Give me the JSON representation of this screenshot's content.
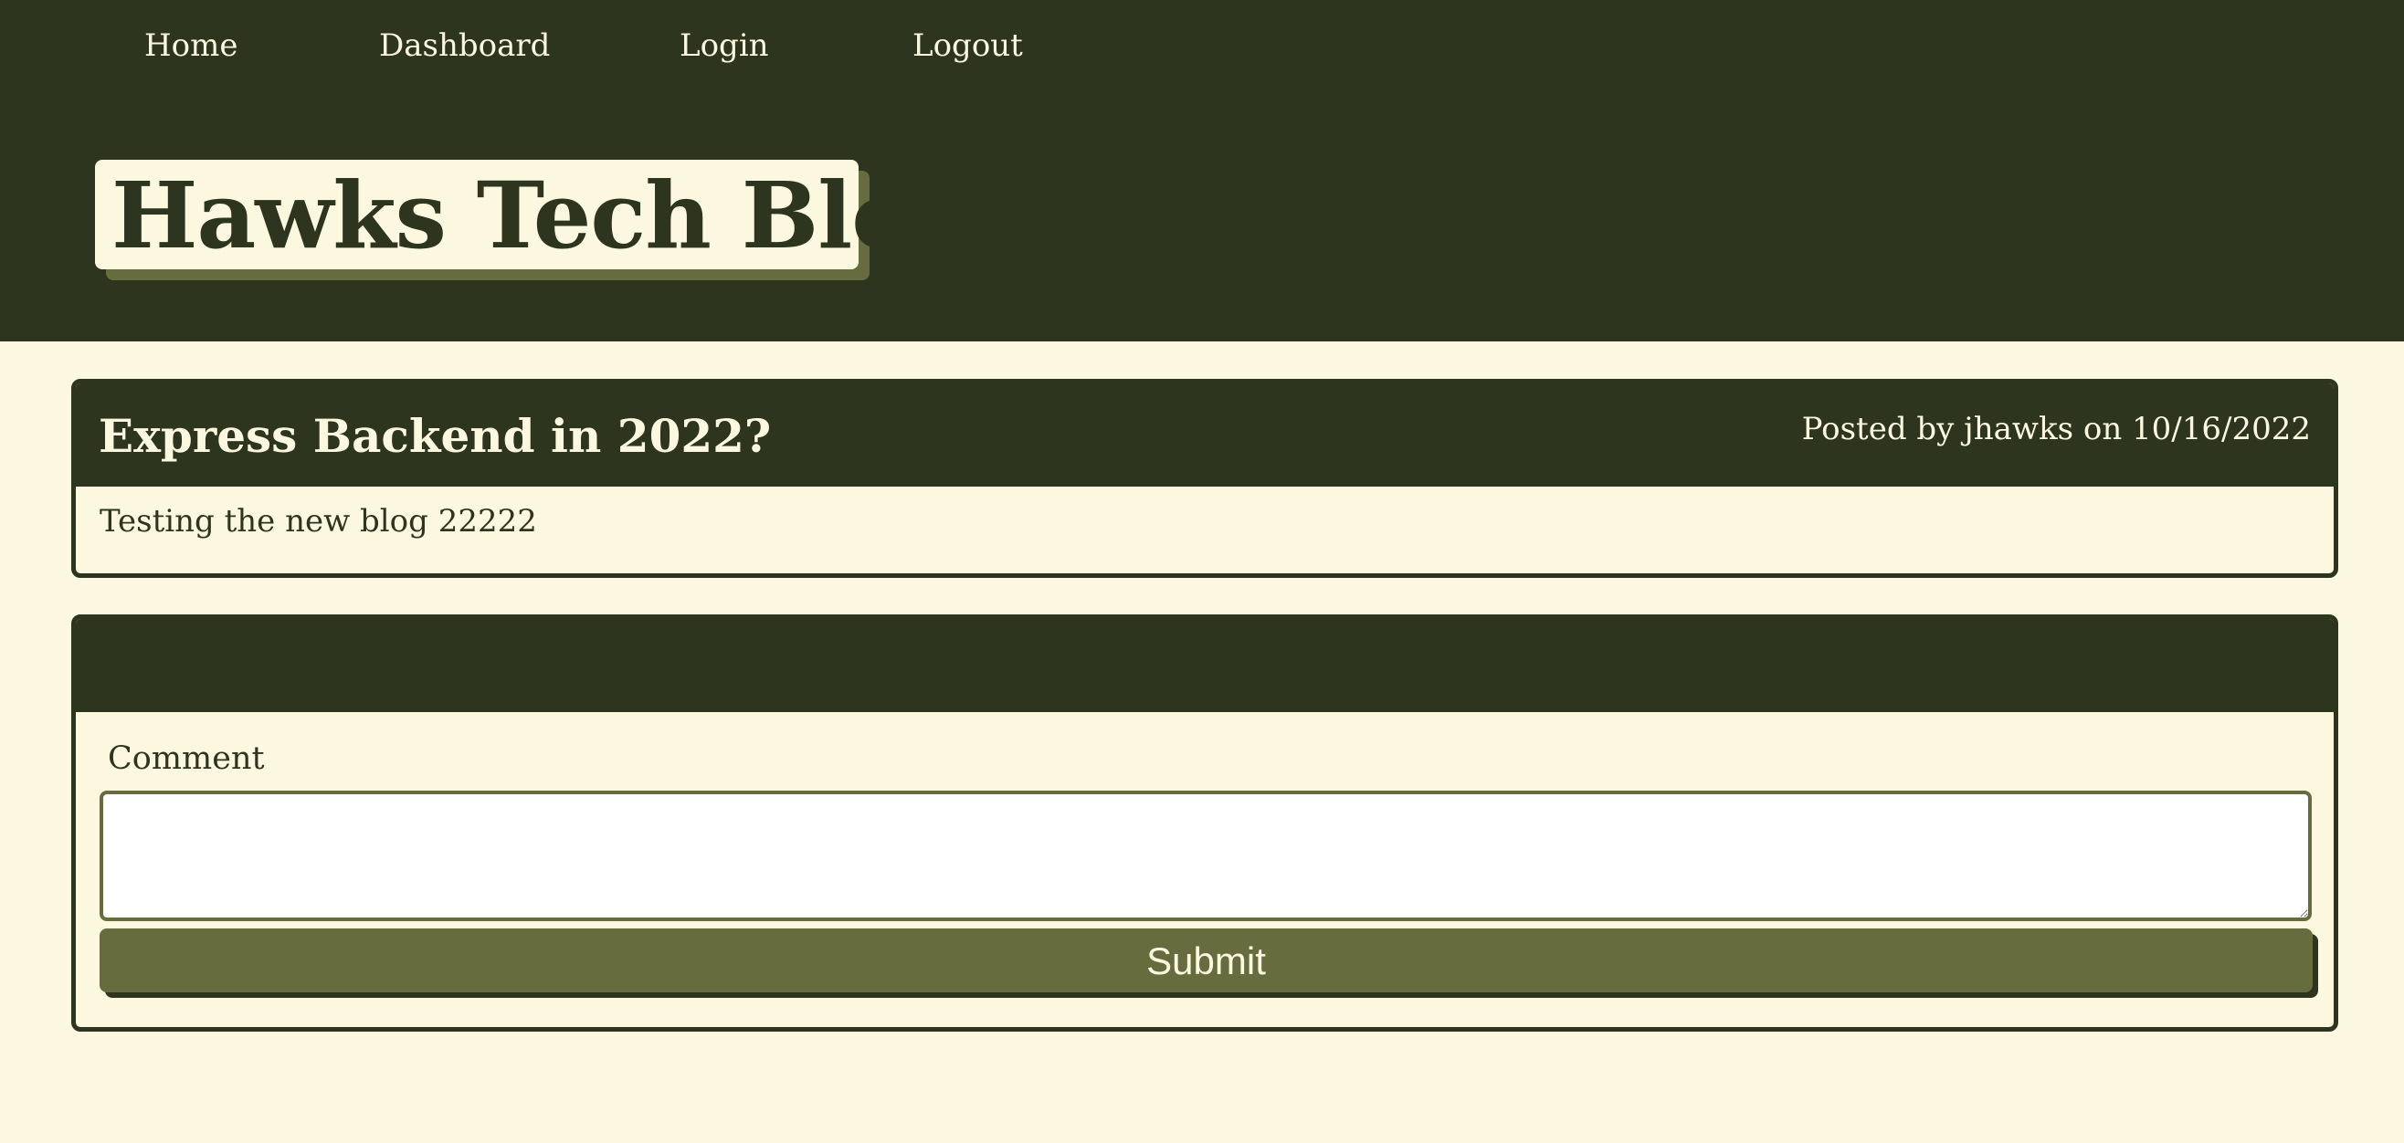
{
  "nav": {
    "items": [
      {
        "label": "Home"
      },
      {
        "label": "Dashboard"
      },
      {
        "label": "Login"
      },
      {
        "label": "Logout"
      }
    ]
  },
  "site": {
    "title": "Hawks Tech Blog"
  },
  "post": {
    "title": "Express Backend in 2022?",
    "meta": "Posted by jhawks on 10/16/2022",
    "body": "Testing the new blog 22222"
  },
  "comment_form": {
    "label": "Comment",
    "value": "",
    "submit_label": "Submit"
  },
  "colors": {
    "header_bg": "#2d351f",
    "page_bg": "#fcf8e0",
    "accent": "#666c3e",
    "input_bg": "#ffffff"
  }
}
